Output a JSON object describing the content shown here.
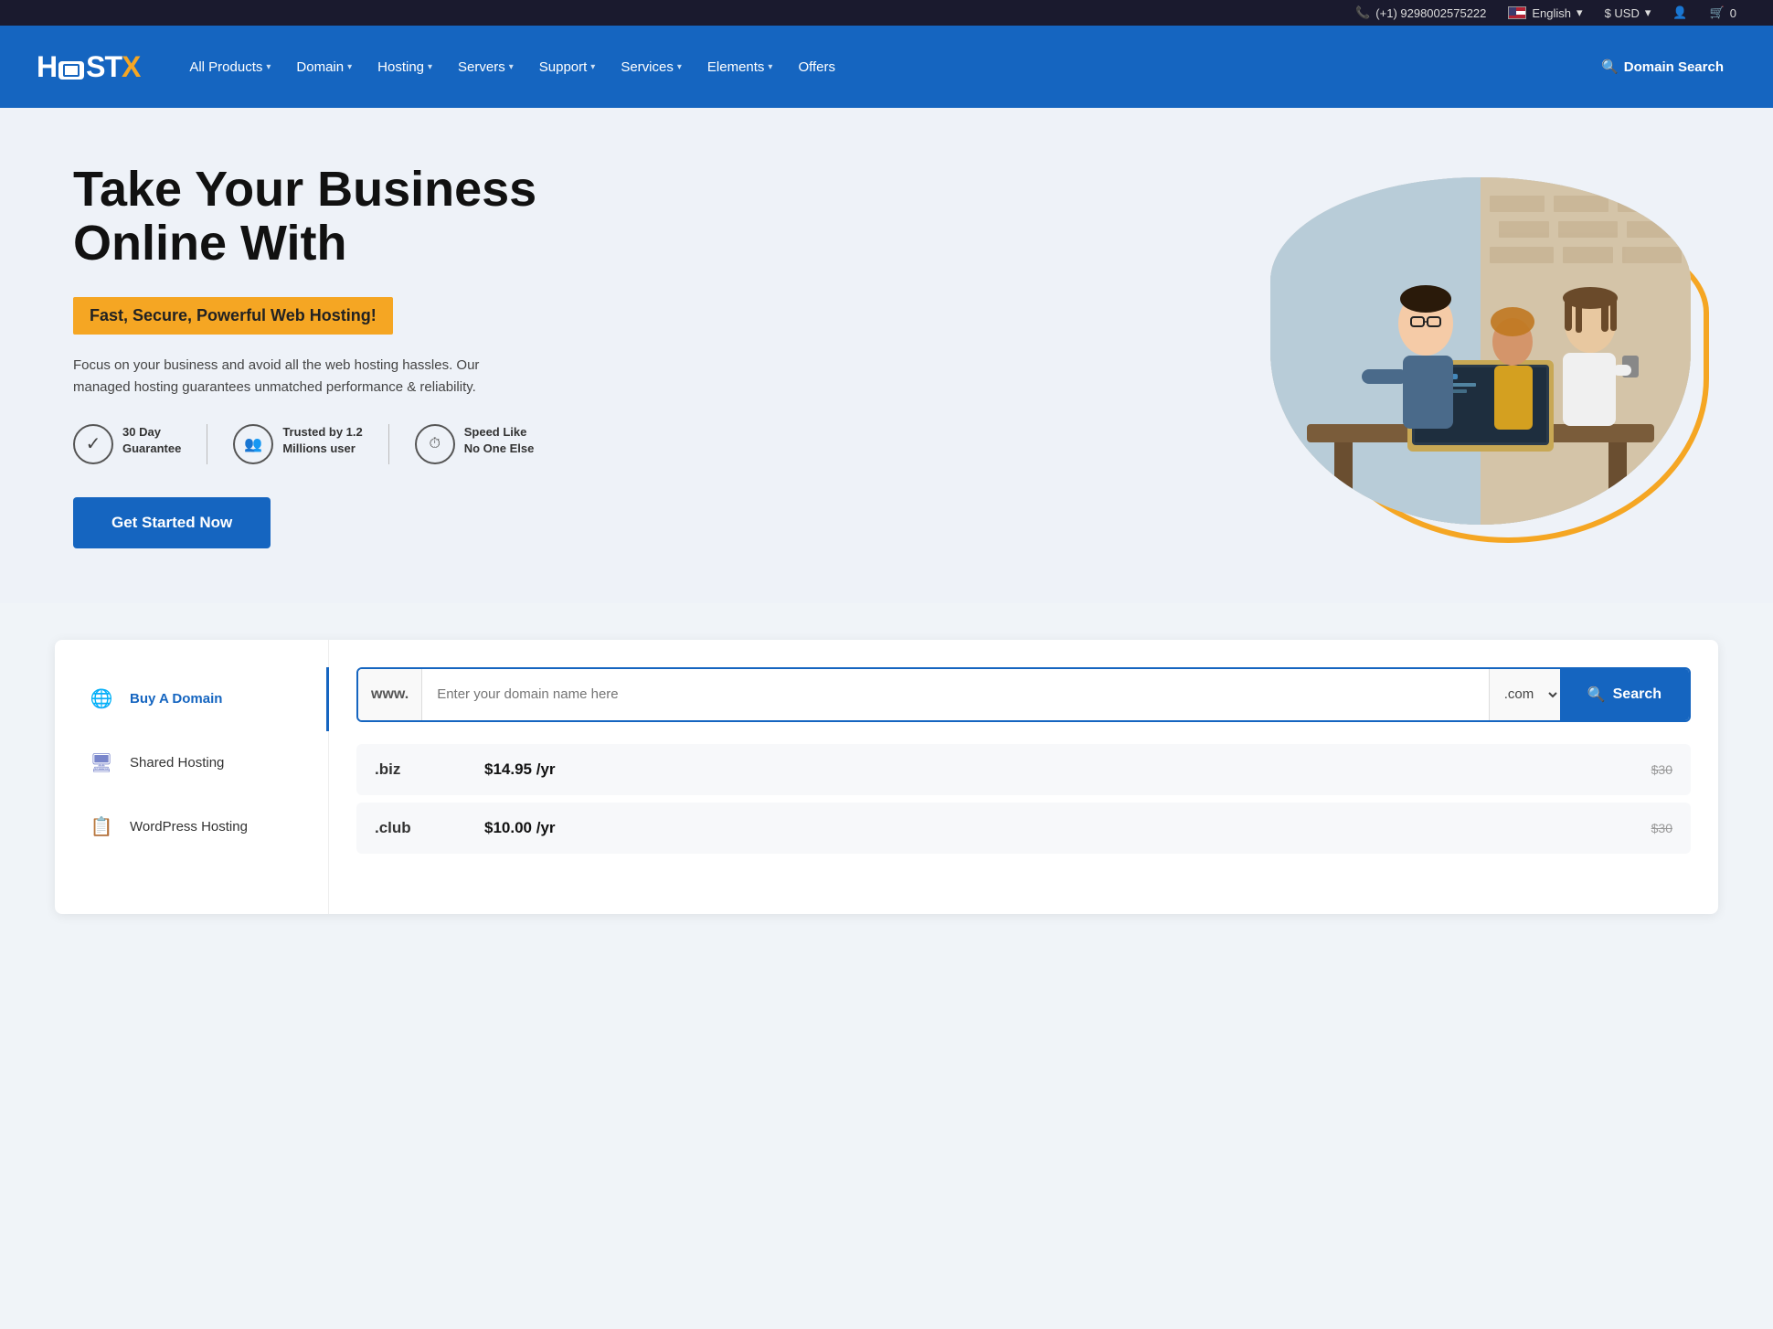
{
  "topbar": {
    "phone": "(+1) 9298002575222",
    "language": "English",
    "currency": "$ USD",
    "cart_count": "0"
  },
  "nav": {
    "logo_text_host": "H",
    "logo_text_ost": "OST",
    "logo_x": "X",
    "links": [
      {
        "label": "All Products",
        "has_dropdown": true
      },
      {
        "label": "Domain",
        "has_dropdown": true
      },
      {
        "label": "Hosting",
        "has_dropdown": true
      },
      {
        "label": "Servers",
        "has_dropdown": true
      },
      {
        "label": "Support",
        "has_dropdown": true
      },
      {
        "label": "Services",
        "has_dropdown": true
      },
      {
        "label": "Elements",
        "has_dropdown": true
      },
      {
        "label": "Offers",
        "has_dropdown": false
      }
    ],
    "domain_search_label": "Domain Search"
  },
  "hero": {
    "title_line1": "Take Your Business",
    "title_line2": "Online With",
    "subtitle": "Fast, Secure, Powerful Web Hosting!",
    "description": "Focus on your business and avoid all the web hosting hassles. Our managed hosting guarantees unmatched performance & reliability.",
    "badges": [
      {
        "icon": "✓",
        "line1": "30 Day",
        "line2": "Guarantee"
      },
      {
        "icon": "👥",
        "line1": "Trusted by 1.2",
        "line2": "Millions user"
      },
      {
        "icon": "⏱",
        "line1": "Speed Like",
        "line2": "No One Else"
      }
    ],
    "cta_button": "Get Started Now"
  },
  "domain_section": {
    "sidebar_items": [
      {
        "label": "Buy A Domain",
        "icon": "🌐",
        "active": true
      },
      {
        "label": "Shared Hosting",
        "icon": "🖥",
        "active": false
      },
      {
        "label": "WordPress Hosting",
        "icon": "📋",
        "active": false
      }
    ],
    "search": {
      "www_label": "www.",
      "placeholder": "Enter your domain name here",
      "tld_default": ".com",
      "button_label": "Search"
    },
    "pricing": [
      {
        "ext": ".biz",
        "price": "$14.95 /yr",
        "old_price": "$30"
      },
      {
        "ext": ".club",
        "price": "$10.00 /yr",
        "old_price": "$30"
      }
    ]
  }
}
